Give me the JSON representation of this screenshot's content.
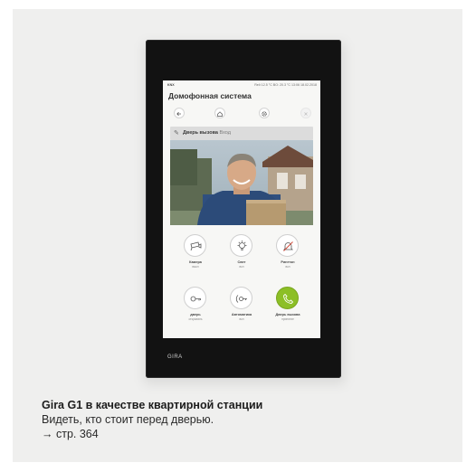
{
  "device": {
    "brand": "GIRA",
    "status_bar": {
      "left": "KNX",
      "right": "Reð 12.5 °C  BO: 20.3 °C  13:06  18.02.2018"
    },
    "screen_title": "Домофонная система",
    "nav_icons": [
      "back-arrow-icon",
      "home-icon",
      "gear-icon",
      "close-icon"
    ],
    "camera_caption": {
      "label": "Дверь вызова",
      "sublabel": "Вход"
    },
    "buttons": [
      {
        "name": "camera",
        "label": "Камера",
        "state": "выкл",
        "icon": "camera-icon"
      },
      {
        "name": "light",
        "label": "Свет",
        "state": "вкл",
        "icon": "light-bulb-icon"
      },
      {
        "name": "ringtone",
        "label": "Рингтон",
        "state": "вкл",
        "icon": "bell-muted-icon"
      },
      {
        "name": "door",
        "label": "дверь",
        "state": "открывать",
        "icon": "key-icon"
      },
      {
        "name": "auto",
        "label": "Автоматика",
        "state": "вкл",
        "icon": "auto-key-icon"
      },
      {
        "name": "call-door",
        "label": "Дверь вызова",
        "state": "принятие",
        "icon": "phone-icon",
        "active_color": "#8cbf26"
      }
    ]
  },
  "caption": {
    "title": "Gira G1 в качестве квартирной станции",
    "line2": "Видеть, кто стоит перед дверью.",
    "line3": "→ стр. 364"
  }
}
